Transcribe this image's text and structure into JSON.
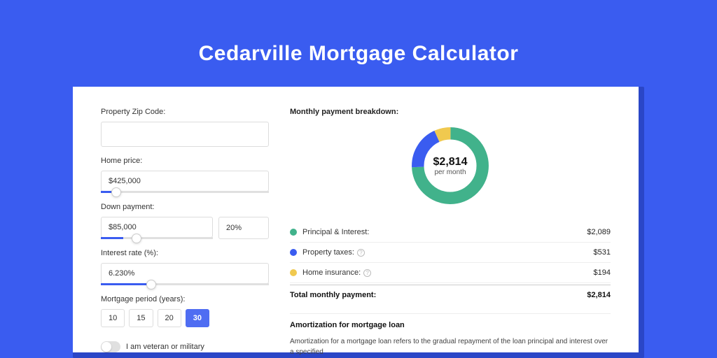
{
  "page": {
    "title": "Cedarville Mortgage Calculator"
  },
  "form": {
    "zip_label": "Property Zip Code:",
    "zip_value": "",
    "home_price_label": "Home price:",
    "home_price_value": "$425,000",
    "home_price_slider_position_pct": 9,
    "down_payment_label": "Down payment:",
    "down_payment_value": "$85,000",
    "down_payment_percent": "20%",
    "down_payment_slider_position_pct": 20,
    "interest_label": "Interest rate (%):",
    "interest_value": "6.230%",
    "interest_slider_position_pct": 30,
    "period_label": "Mortgage period (years):",
    "period_options": [
      "10",
      "15",
      "20",
      "30"
    ],
    "period_selected_index": 3,
    "veteran_label": "I am veteran or military",
    "veteran_on": false
  },
  "breakdown": {
    "title": "Monthly payment breakdown:",
    "donut_center_value": "$2,814",
    "donut_center_label": "per month",
    "items": [
      {
        "name": "Principal & Interest:",
        "value": "$2,089",
        "color": "#41b28b",
        "has_info": false
      },
      {
        "name": "Property taxes:",
        "value": "$531",
        "color": "#3a5cf0",
        "has_info": true
      },
      {
        "name": "Home insurance:",
        "value": "$194",
        "color": "#f0c94f",
        "has_info": true
      }
    ],
    "total_label": "Total monthly payment:",
    "total_value": "$2,814"
  },
  "amortization": {
    "title": "Amortization for mortgage loan",
    "text": "Amortization for a mortgage loan refers to the gradual repayment of the loan principal and interest over a specified"
  },
  "chart_data": {
    "type": "pie",
    "title": "Monthly payment breakdown",
    "series": [
      {
        "name": "Principal & Interest",
        "value": 2089,
        "color": "#41b28b"
      },
      {
        "name": "Property taxes",
        "value": 531,
        "color": "#3a5cf0"
      },
      {
        "name": "Home insurance",
        "value": 194,
        "color": "#f0c94f"
      }
    ],
    "total": 2814,
    "center_label": "$2,814 per month"
  }
}
